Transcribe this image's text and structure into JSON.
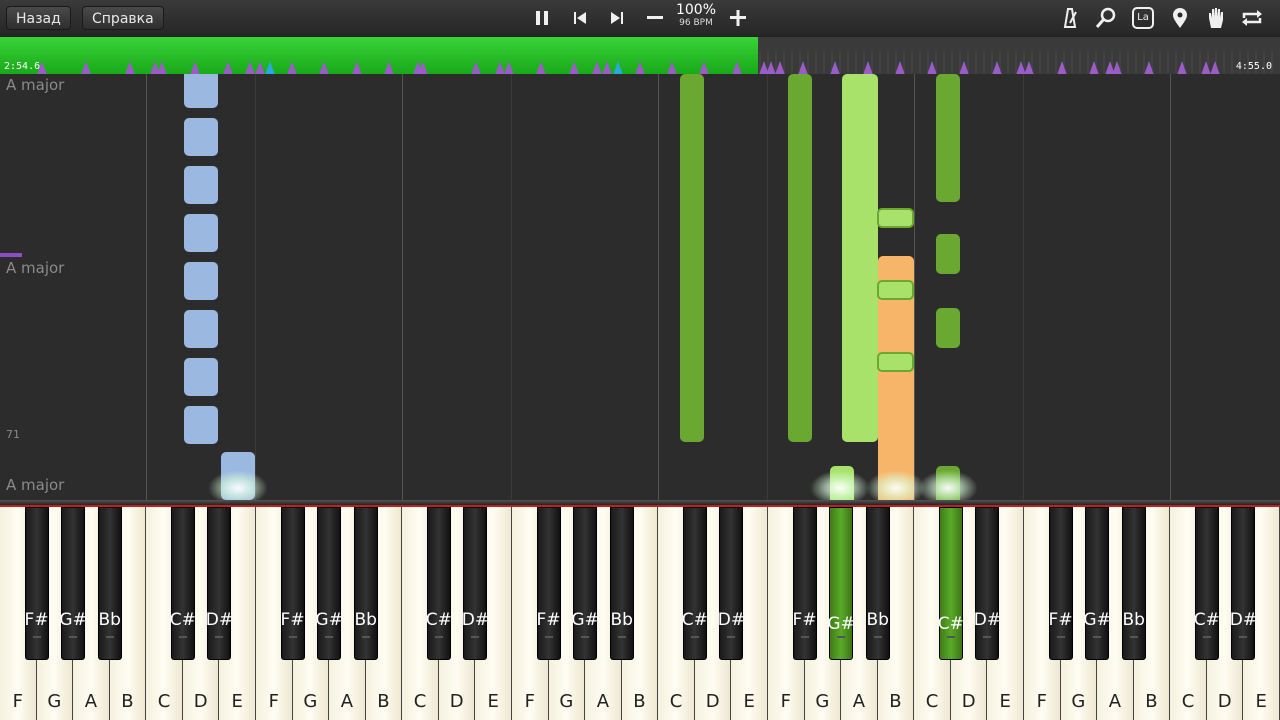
{
  "toolbar": {
    "back_label": "Назад",
    "help_label": "Справка",
    "zoom": "100%",
    "bpm": "96 BPM",
    "tempo_minus_icon": "minus-icon",
    "tempo_plus_icon": "plus-icon",
    "right_icons": [
      "metronome-icon",
      "search-icon",
      "key-label-icon",
      "marker-icon",
      "hand-icon",
      "loop-icon"
    ],
    "key_icon_text": "La"
  },
  "progress": {
    "current_time": "2:54.6",
    "total_time": "4:55.0",
    "played_fraction": 0.592,
    "colors": {
      "played": "#22b822",
      "remaining": "#3a3a3a",
      "marker": "#9a5cc6",
      "marker_current": "#2aa7e0"
    }
  },
  "roll": {
    "key_labels": [
      "A major",
      "A major",
      "A major"
    ],
    "measure_number": "71",
    "colors": {
      "left_hand": "#9ab8e0",
      "right_hand_dark": "#6aa832",
      "right_hand_light": "#a8e26a",
      "held_note": "#f7b56a"
    }
  },
  "keyboard": {
    "white_keys": [
      "F",
      "G",
      "A",
      "B",
      "C",
      "D",
      "E",
      "F",
      "G",
      "A",
      "B",
      "C",
      "D",
      "E",
      "F",
      "G",
      "A",
      "B",
      "C",
      "D",
      "E",
      "F",
      "G",
      "A",
      "B",
      "C",
      "D",
      "E",
      "F",
      "G",
      "A",
      "B",
      "C",
      "D",
      "E"
    ],
    "black_keys": [
      "F#",
      "G#",
      "Bb",
      "C#",
      "D#",
      "F#",
      "G#",
      "Bb",
      "C#",
      "D#",
      "F#",
      "G#",
      "Bb",
      "C#",
      "D#",
      "F#",
      "G#",
      "Bb",
      "C#",
      "D#",
      "F#",
      "G#",
      "Bb",
      "C#",
      "D#"
    ],
    "highlighted_black_keys": [
      "G#",
      "C#"
    ],
    "highlight_color": "#5aaa28"
  }
}
